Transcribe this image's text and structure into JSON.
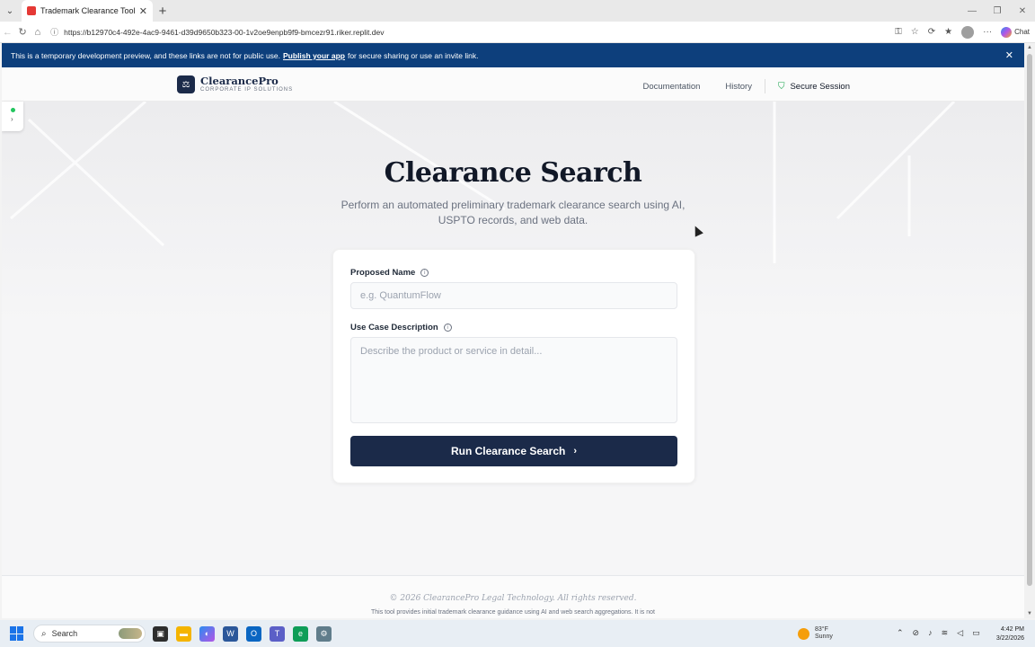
{
  "browser": {
    "tab_title": "Trademark Clearance Tool",
    "url": "https://b12970c4-492e-4ac9-9461-d39d9650b323-00-1v2oe9enpb9f9-bmcezr91.riker.replit.dev",
    "chat_label": "Chat"
  },
  "banner": {
    "text_before": "This is a temporary development preview, and these links are not for public use.",
    "link": "Publish your app",
    "text_after": "for secure sharing or use an invite link."
  },
  "header": {
    "brand_name": "ClearancePro",
    "brand_sub": "CORPORATE IP SOLUTIONS",
    "nav": [
      "Documentation",
      "History"
    ],
    "secure_label": "Secure Session"
  },
  "hero": {
    "title": "Clearance Search",
    "subtitle": "Perform an automated preliminary trademark clearance search using AI, USPTO records, and web data."
  },
  "form": {
    "name_label": "Proposed Name",
    "name_placeholder": "e.g. QuantumFlow",
    "desc_label": "Use Case Description",
    "desc_placeholder": "Describe the product or service in detail...",
    "submit_label": "Run Clearance Search"
  },
  "footer": {
    "copyright": "© 2026 ClearancePro Legal Technology. All rights reserved.",
    "disclaimer": "This tool provides initial trademark clearance guidance using AI and web search aggregations. It is not"
  },
  "taskbar": {
    "search_label": "Search",
    "weather_temp": "83°F",
    "weather_desc": "Sunny",
    "time": "4:42 PM",
    "date": "3/22/2026"
  },
  "colors": {
    "navy": "#1b2a49",
    "banner": "#0d3f7c",
    "secure_green": "#16a34a"
  }
}
